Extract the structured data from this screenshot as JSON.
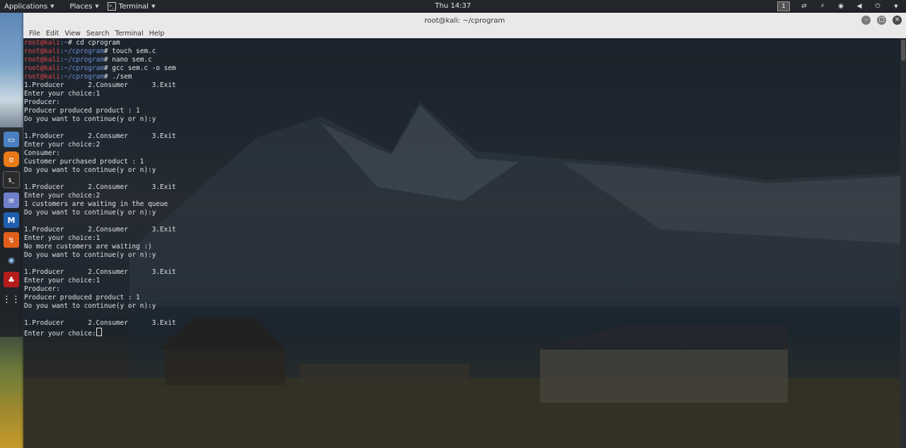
{
  "top_panel": {
    "applications": "Applications",
    "places": "Places",
    "terminal": "Terminal",
    "clock": "Thu 14:37",
    "workspace": "1"
  },
  "window": {
    "title": "root@kali: ~/cprogram",
    "menu": [
      "File",
      "Edit",
      "View",
      "Search",
      "Terminal",
      "Help"
    ]
  },
  "dock": {
    "items": [
      "files-icon",
      "burp-icon",
      "terminal-icon",
      "text-editor-icon",
      "metasploit-icon",
      "armitage-icon",
      "eye-icon",
      "cherrytree-icon",
      "apps-grid-icon"
    ]
  },
  "terminal": {
    "lines": [
      {
        "user": "root@kali",
        "path": ":~",
        "cmd": "# cd cprogram"
      },
      {
        "user": "root@kali",
        "path": ":~/cprogram",
        "cmd": "# touch sem.c"
      },
      {
        "user": "root@kali",
        "path": ":~/cprogram",
        "cmd": "# nano sem.c"
      },
      {
        "user": "root@kali",
        "path": ":~/cprogram",
        "cmd": "# gcc sem.c -o sem"
      },
      {
        "user": "root@kali",
        "path": ":~/cprogram",
        "cmd": "# ./sem"
      },
      {
        "text": "1.Producer      2.Consumer      3.Exit"
      },
      {
        "text": "Enter your choice:1"
      },
      {
        "text": "Producer:"
      },
      {
        "text": "Producer produced product : 1"
      },
      {
        "text": "Do you want to continue(y or n):y"
      },
      {
        "text": ""
      },
      {
        "text": "1.Producer      2.Consumer      3.Exit"
      },
      {
        "text": "Enter your choice:2"
      },
      {
        "text": "Consumer:"
      },
      {
        "text": "Customer purchased product : 1"
      },
      {
        "text": "Do you want to continue(y or n):y"
      },
      {
        "text": ""
      },
      {
        "text": "1.Producer      2.Consumer      3.Exit"
      },
      {
        "text": "Enter your choice:2"
      },
      {
        "text": "1 customers are waiting in the queue"
      },
      {
        "text": "Do you want to continue(y or n):y"
      },
      {
        "text": ""
      },
      {
        "text": "1.Producer      2.Consumer      3.Exit"
      },
      {
        "text": "Enter your choice:1"
      },
      {
        "text": "No more customers are waiting :)"
      },
      {
        "text": "Do you want to continue(y or n):y"
      },
      {
        "text": ""
      },
      {
        "text": "1.Producer      2.Consumer      3.Exit"
      },
      {
        "text": "Enter your choice:1"
      },
      {
        "text": "Producer:"
      },
      {
        "text": "Producer produced product : 1"
      },
      {
        "text": "Do you want to continue(y or n):y"
      },
      {
        "text": ""
      },
      {
        "text": "1.Producer      2.Consumer      3.Exit"
      },
      {
        "text": "Enter your choice:",
        "cursor": true
      }
    ]
  }
}
